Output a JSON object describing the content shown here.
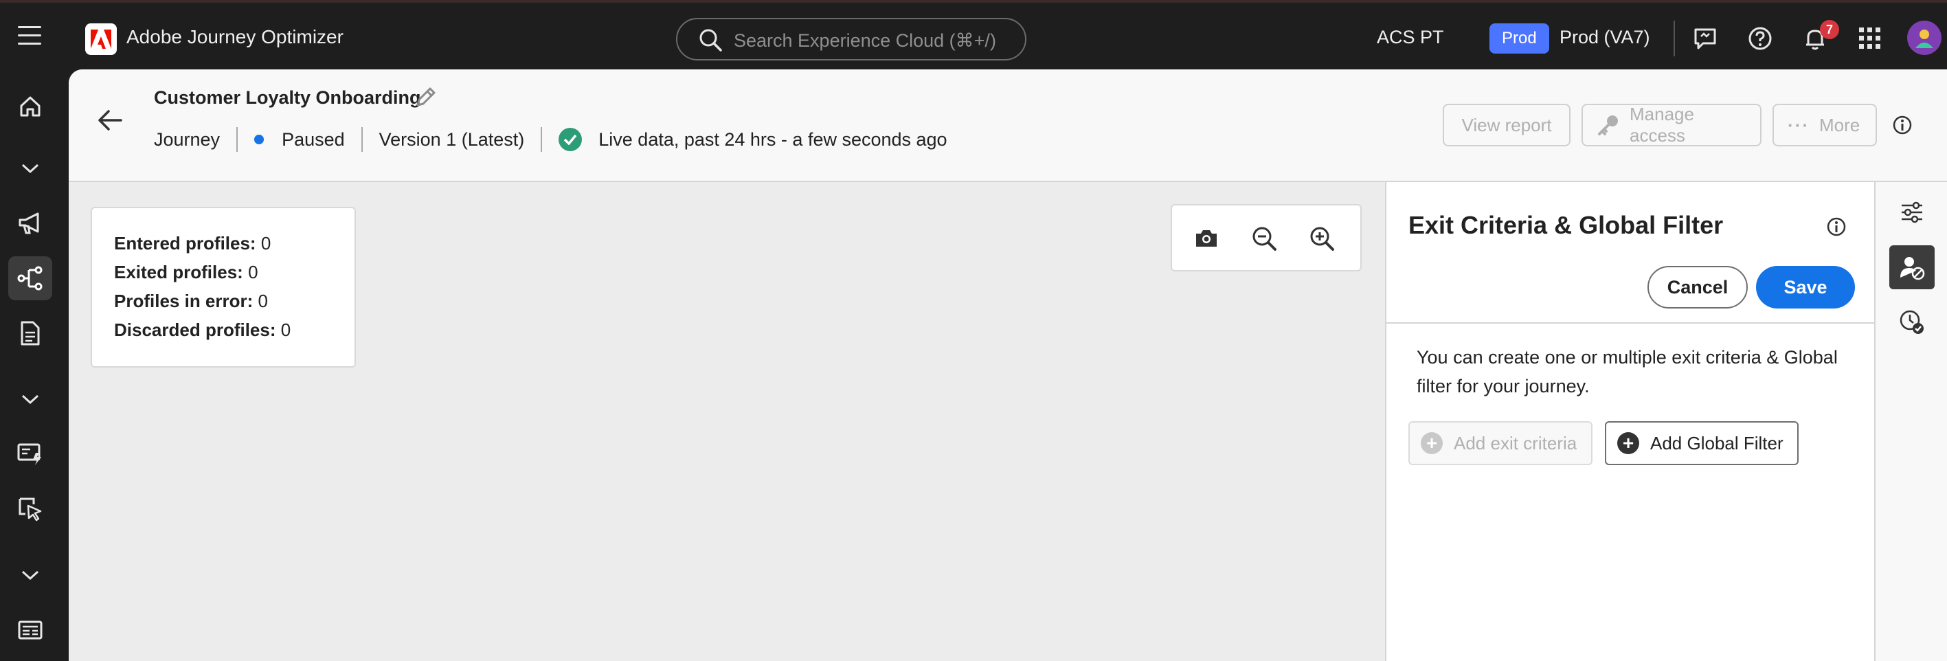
{
  "app": {
    "title": "Adobe Journey Optimizer"
  },
  "search": {
    "placeholder": "Search Experience Cloud (⌘+/)"
  },
  "org": {
    "name": "ACS PT",
    "sandbox_badge": "Prod",
    "sandbox_name": "Prod (VA7)"
  },
  "notifications": {
    "count": "7"
  },
  "rail": {
    "items": [
      {
        "icon": "home-icon"
      },
      {
        "icon": "chevron-down-icon"
      },
      {
        "icon": "megaphone-icon"
      },
      {
        "icon": "journey-icon",
        "active": true
      },
      {
        "icon": "document-icon"
      },
      {
        "icon": "chevron-down-icon"
      },
      {
        "icon": "decision-icon"
      },
      {
        "icon": "select-icon"
      },
      {
        "icon": "chevron-down-icon"
      },
      {
        "icon": "card-icon"
      }
    ]
  },
  "journey": {
    "name": "Customer Loyalty Onboarding",
    "type": "Journey",
    "status": "Paused",
    "version": "Version 1 (Latest)",
    "live_data": "Live data, past 24 hrs - a few seconds ago"
  },
  "header_buttons": {
    "view_report": "View report",
    "manage_access": "Manage access",
    "more": "More"
  },
  "stats": {
    "entered_label": "Entered profiles:",
    "entered_value": "0",
    "exited_label": "Exited profiles:",
    "exited_value": "0",
    "error_label": "Profiles in error:",
    "error_value": "0",
    "discarded_label": "Discarded profiles:",
    "discarded_value": "0"
  },
  "panel": {
    "title": "Exit Criteria & Global Filter",
    "cancel": "Cancel",
    "save": "Save",
    "description": "You can create one or multiple exit criteria & Global filter for your journey.",
    "add_exit": "Add exit criteria",
    "add_global": "Add Global Filter"
  },
  "colors": {
    "accent": "#1473e6",
    "sandbox": "#4b75ff",
    "success": "#2d9d78",
    "badge": "#d7373f"
  }
}
